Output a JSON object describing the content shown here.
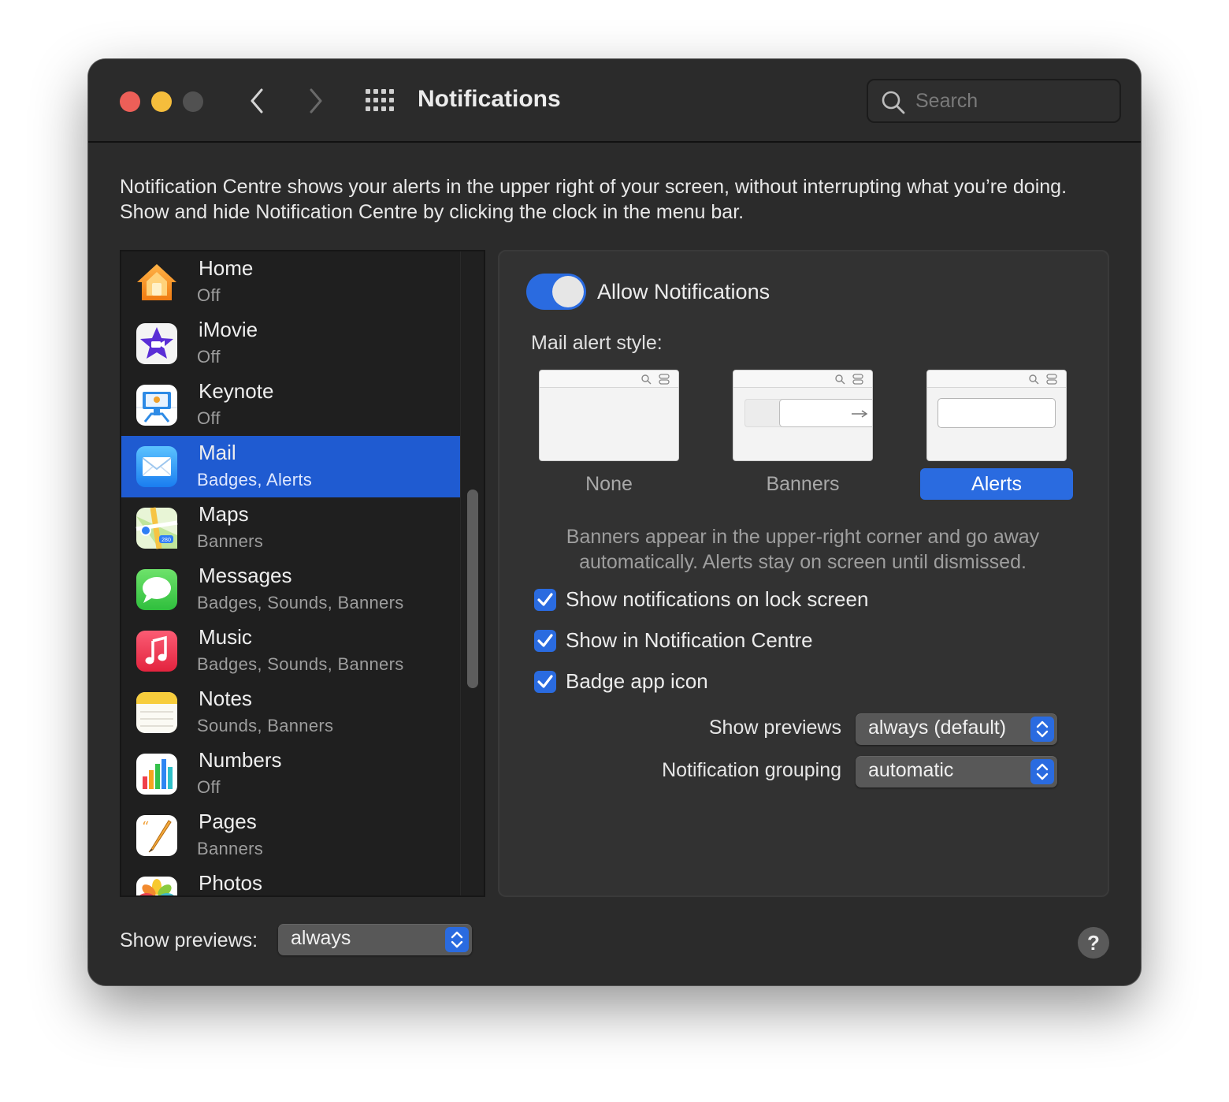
{
  "window": {
    "title": "Notifications",
    "search_placeholder": "Search"
  },
  "intro_text": "Notification Centre shows your alerts in the upper right of your screen, without interrupting what you’re doing. Show and hide Notification Centre by clicking the clock in the menu bar.",
  "apps": [
    {
      "name": "Home",
      "status": "Off",
      "icon": "home-app-icon"
    },
    {
      "name": "iMovie",
      "status": "Off",
      "icon": "imovie-app-icon"
    },
    {
      "name": "Keynote",
      "status": "Off",
      "icon": "keynote-app-icon"
    },
    {
      "name": "Mail",
      "status": "Badges, Alerts",
      "icon": "mail-app-icon",
      "selected": true
    },
    {
      "name": "Maps",
      "status": "Banners",
      "icon": "maps-app-icon"
    },
    {
      "name": "Messages",
      "status": "Badges, Sounds, Banners",
      "icon": "messages-app-icon"
    },
    {
      "name": "Music",
      "status": "Badges, Sounds, Banners",
      "icon": "music-app-icon"
    },
    {
      "name": "Notes",
      "status": "Sounds, Banners",
      "icon": "notes-app-icon"
    },
    {
      "name": "Numbers",
      "status": "Off",
      "icon": "numbers-app-icon"
    },
    {
      "name": "Pages",
      "status": "Banners",
      "icon": "pages-app-icon"
    },
    {
      "name": "Photos",
      "status": "",
      "icon": "photos-app-icon"
    }
  ],
  "detail": {
    "allow_label": "Allow Notifications",
    "allow_enabled": true,
    "style_label": "Mail alert style:",
    "styles": [
      {
        "label": "None",
        "selected": false
      },
      {
        "label": "Banners",
        "selected": false
      },
      {
        "label": "Alerts",
        "selected": true
      }
    ],
    "style_description": "Banners appear in the upper-right corner and go away automatically. Alerts stay on screen until dismissed.",
    "options": [
      {
        "label": "Show notifications on lock screen",
        "checked": true
      },
      {
        "label": "Show in Notification Centre",
        "checked": true
      },
      {
        "label": "Badge app icon",
        "checked": true
      }
    ],
    "show_previews": {
      "label": "Show previews",
      "value": "always (default)"
    },
    "grouping": {
      "label": "Notification grouping",
      "value": "automatic"
    }
  },
  "footer": {
    "show_previews_label": "Show previews:",
    "show_previews_value": "always",
    "help_label": "?"
  },
  "colors": {
    "accent": "#2a6be0",
    "selection": "#1f5bd1",
    "window_bg": "#2b2b2b"
  }
}
